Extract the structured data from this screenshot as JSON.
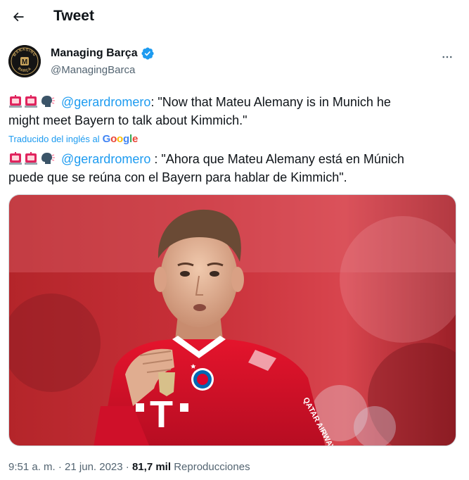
{
  "header": {
    "title": "Tweet",
    "back_icon": "arrow-left-icon"
  },
  "author": {
    "name": "Managing Barça",
    "handle": "@ManagingBarca",
    "verified_icon": "verified-badge-icon",
    "avatar_logo_text": "MANAGING BARÇA",
    "avatar_letter": "M",
    "more_icon": "more-horizontal-icon"
  },
  "tweet": {
    "original": {
      "emojis": [
        "police-light-emoji",
        "police-light-emoji",
        "speaking-head-emoji"
      ],
      "mention": "@gerardromero",
      "line1_rest": ": \"Now that Mateu Alemany is in Munich he",
      "line2": "might meet Bayern to talk about Kimmich.\""
    },
    "translation_label": "Traducido del inglés al",
    "translation_brand": "Google",
    "translated": {
      "emojis": [
        "police-light-emoji",
        "police-light-emoji",
        "speaking-head-emoji"
      ],
      "mention": "@gerardromero",
      "line1_rest": " : \"Ahora que Mateu Alemany está en Múnich",
      "line2": "puede que se reúna con el Bayern para hablar de Kimmich\"."
    },
    "media": {
      "type": "photo",
      "jersey_text": "QATAR AIRWAYS",
      "sponsor_mark": "T"
    }
  },
  "meta": {
    "time": "9:51 a. m.",
    "separator": "·",
    "date": "21 jun. 2023",
    "views_count": "81,7 mil",
    "views_label": "Reproducciones"
  },
  "colors": {
    "accent": "#1d9bf0",
    "text": "#0f1419",
    "secondary": "#536471",
    "jersey": "#dc052d"
  }
}
